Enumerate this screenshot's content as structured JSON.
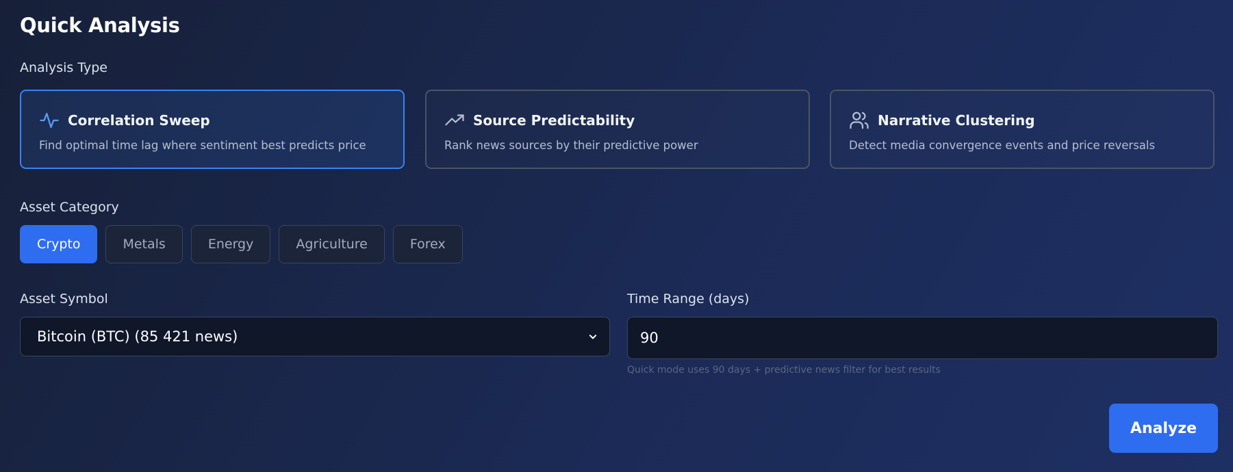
{
  "page": {
    "title": "Quick Analysis"
  },
  "analysis_type": {
    "label": "Analysis Type",
    "options": [
      {
        "icon": "activity-pulse-icon",
        "title": "Correlation Sweep",
        "description": "Find optimal time lag where sentiment best predicts price",
        "selected": true
      },
      {
        "icon": "trending-up-icon",
        "title": "Source Predictability",
        "description": "Rank news sources by their predictive power",
        "selected": false
      },
      {
        "icon": "users-icon",
        "title": "Narrative Clustering",
        "description": "Detect media convergence events and price reversals",
        "selected": false
      }
    ]
  },
  "asset_category": {
    "label": "Asset Category",
    "options": [
      "Crypto",
      "Metals",
      "Energy",
      "Agriculture",
      "Forex"
    ],
    "selected": "Crypto"
  },
  "asset_symbol": {
    "label": "Asset Symbol",
    "value": "Bitcoin (BTC) (85 421 news)"
  },
  "time_range": {
    "label": "Time Range (days)",
    "value": "90",
    "hint": "Quick mode uses 90 days + predictive news filter for best results"
  },
  "actions": {
    "analyze_label": "Analyze"
  },
  "colors": {
    "accent": "#2f6df0",
    "selected_border": "#3b82f6"
  }
}
